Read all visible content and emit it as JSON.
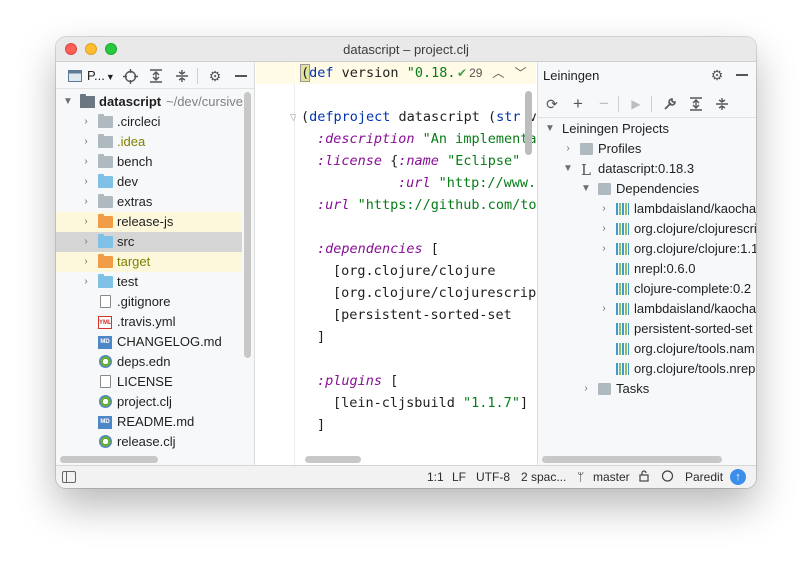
{
  "window": {
    "title": "datascript – project.clj"
  },
  "project_panel": {
    "view_label": "P...",
    "tree": [
      {
        "label": "datascript",
        "suffix": "~/dev/cursive",
        "type": "module",
        "expanded": true
      },
      {
        "label": ".circleci",
        "type": "folder-grey"
      },
      {
        "label": ".idea",
        "type": "folder-grey",
        "color": "#808000"
      },
      {
        "label": "bench",
        "type": "folder-grey"
      },
      {
        "label": "dev",
        "type": "folder-blue"
      },
      {
        "label": "extras",
        "type": "folder-grey"
      },
      {
        "label": "release-js",
        "type": "folder-orange",
        "highlight": "#fdf8dc"
      },
      {
        "label": "src",
        "type": "folder-blue",
        "selected": true
      },
      {
        "label": "target",
        "type": "folder-orange",
        "highlight": "#fdf8dc",
        "color": "#808000"
      },
      {
        "label": "test",
        "type": "folder-blue"
      },
      {
        "label": ".gitignore",
        "type": "file"
      },
      {
        "label": ".travis.yml",
        "type": "yml"
      },
      {
        "label": "CHANGELOG.md",
        "type": "md"
      },
      {
        "label": "deps.edn",
        "type": "clj"
      },
      {
        "label": "LICENSE",
        "type": "file"
      },
      {
        "label": "project.clj",
        "type": "clj"
      },
      {
        "label": "README.md",
        "type": "md"
      },
      {
        "label": "release.clj",
        "type": "clj"
      }
    ]
  },
  "editor": {
    "inspection": {
      "count": "29"
    },
    "lines": {
      "l1_a": "(",
      "l1_def": "def",
      "l1_b": " version ",
      "l1_str": "\"0.18.",
      "l3_a": "(",
      "l3_kw": "defproject",
      "l3_b": " datascript (",
      "l3_kw2": "str",
      "l3_c": " ve",
      "l4_kwd": ":description",
      "l4_str": " \"An implementat",
      "l5_kwd": ":license",
      "l5_b": " {",
      "l5_kwd2": ":name",
      "l5_str": " \"Eclipse\"",
      "l6_kwd": ":url",
      "l6_str": " \"http://www.e",
      "l7_kwd": ":url",
      "l7_str": " \"https://github.com/ton",
      "l9_kwd": ":dependencies",
      "l9_b": " [",
      "l10": "[org.clojure/clojure",
      "l11": "[org.clojure/clojurescript",
      "l12": "[persistent-sorted-set",
      "l13": "]",
      "l15_kwd": ":plugins",
      "l15_b": " [",
      "l16_a": "[lein-cljsbuild ",
      "l16_str": "\"1.1.7\"",
      "l16_b": "]",
      "l17": "]"
    }
  },
  "lein_panel": {
    "title": "Leiningen",
    "tree": [
      {
        "label": "Leiningen Projects",
        "level": 0,
        "arrow": "down"
      },
      {
        "label": "Profiles",
        "level": 1,
        "arrow": "right",
        "icon": "folder"
      },
      {
        "label": "datascript:0.18.3",
        "level": 1,
        "arrow": "down",
        "icon": "lein"
      },
      {
        "label": "Dependencies",
        "level": 2,
        "arrow": "down",
        "icon": "folder"
      },
      {
        "label": "lambdaisland/kaocha",
        "level": 3,
        "arrow": "right",
        "icon": "lib"
      },
      {
        "label": "org.clojure/clojurescript",
        "level": 3,
        "arrow": "right",
        "icon": "lib"
      },
      {
        "label": "org.clojure/clojure:1.1",
        "level": 3,
        "arrow": "right",
        "icon": "lib"
      },
      {
        "label": "nrepl:0.6.0",
        "level": 3,
        "arrow": "",
        "icon": "lib"
      },
      {
        "label": "clojure-complete:0.2",
        "level": 3,
        "arrow": "",
        "icon": "lib"
      },
      {
        "label": "lambdaisland/kaocha",
        "level": 3,
        "arrow": "right",
        "icon": "lib"
      },
      {
        "label": "persistent-sorted-set",
        "level": 3,
        "arrow": "",
        "icon": "lib"
      },
      {
        "label": "org.clojure/tools.nam",
        "level": 3,
        "arrow": "",
        "icon": "lib"
      },
      {
        "label": "org.clojure/tools.nrep",
        "level": 3,
        "arrow": "",
        "icon": "lib"
      },
      {
        "label": "Tasks",
        "level": 2,
        "arrow": "right",
        "icon": "folder"
      }
    ]
  },
  "statusbar": {
    "position": "1:1",
    "line_sep": "LF",
    "encoding": "UTF-8",
    "indent": "2 spac...",
    "branch": "master",
    "mode": "Paredit"
  }
}
